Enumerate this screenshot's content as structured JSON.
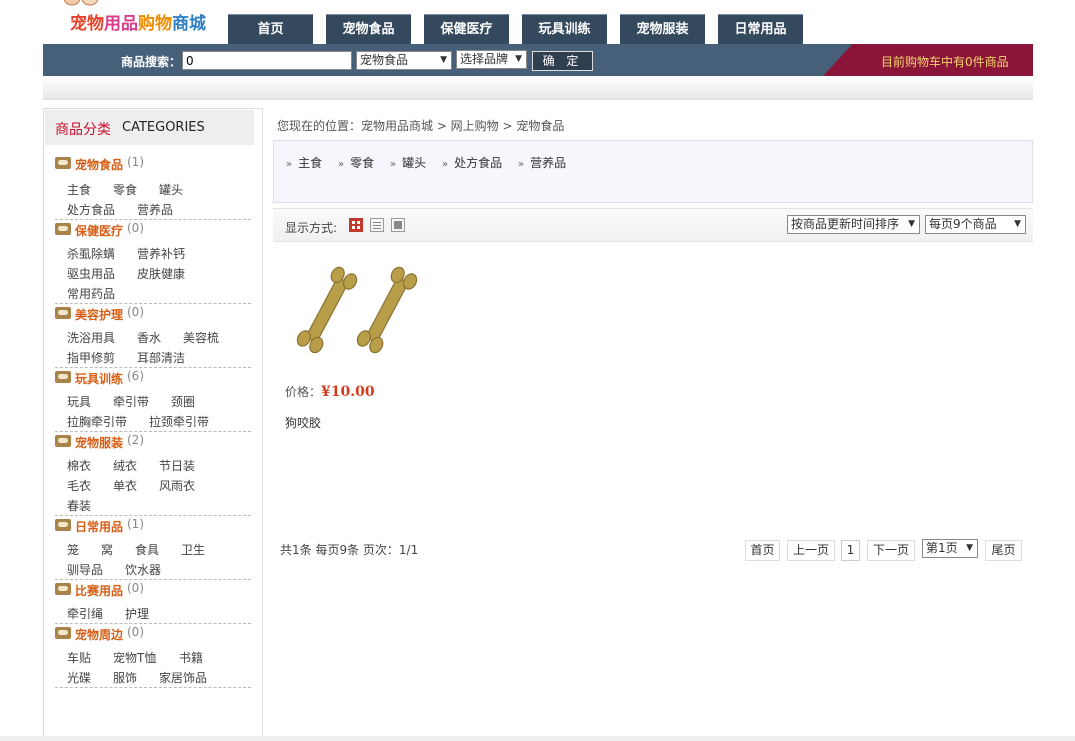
{
  "brand": {
    "name_chars": [
      "宠",
      "物",
      "用",
      "品",
      "购",
      "物",
      "商",
      "城"
    ],
    "colors": [
      "#e8432a",
      "#e8432a",
      "#d93c8a",
      "#d93c8a",
      "#f08c00",
      "#f08c00",
      "#2f7fc1",
      "#2f7fc1"
    ]
  },
  "nav": {
    "tabs": [
      "首页",
      "宠物食品",
      "保健医疗",
      "玩具训练",
      "宠物服装",
      "日常用品"
    ]
  },
  "search": {
    "label": "商品搜索：",
    "keyword": "0",
    "category_select": "宠物食品",
    "brand_select": "选择品牌",
    "submit": "确 定"
  },
  "cart": {
    "text": "目前购物车中有0件商品"
  },
  "sidebar": {
    "title_cn": "商品分类",
    "title_en": "CATEGORIES",
    "categories": [
      {
        "name": "宠物食品",
        "count": "(1)",
        "subs": [
          "主食",
          "零食",
          "罐头",
          "处方食品",
          "营养品"
        ]
      },
      {
        "name": "保健医疗",
        "count": "(0)",
        "subs": [
          "杀虱除螨",
          "营养补钙",
          "驱虫用品",
          "皮肤健康",
          "常用药品"
        ]
      },
      {
        "name": "美容护理",
        "count": "(0)",
        "subs": [
          "洗浴用具",
          "香水",
          "美容梳",
          "指甲修剪",
          "耳部清洁"
        ]
      },
      {
        "name": "玩具训练",
        "count": "(6)",
        "subs": [
          "玩具",
          "牵引带",
          "颈圈",
          "拉胸牵引带",
          "拉颈牵引带"
        ]
      },
      {
        "name": "宠物服装",
        "count": "(2)",
        "subs": [
          "棉衣",
          "绒衣",
          "节日装",
          "毛衣",
          "单衣",
          "风雨衣",
          "春装"
        ]
      },
      {
        "name": "日常用品",
        "count": "(1)",
        "subs": [
          "笼",
          "窝",
          "食具",
          "卫生",
          "驯导品",
          "饮水器"
        ]
      },
      {
        "name": "比赛用品",
        "count": "(0)",
        "subs": [
          "牵引绳",
          "护理"
        ]
      },
      {
        "name": "宠物周边",
        "count": "(0)",
        "subs": [
          "车贴",
          "宠物T恤",
          "书籍",
          "光碟",
          "服饰",
          "家居饰品"
        ]
      }
    ]
  },
  "breadcrumb": "您现在的位置：宠物用品商城 > 网上购物 > 宠物食品",
  "subcategories": [
    "主食",
    "零食",
    "罐头",
    "处方食品",
    "营养品"
  ],
  "toolbar": {
    "display_label": "显示方式:",
    "sort_select": "按商品更新时间排序",
    "per_page_select": "每页9个商品"
  },
  "product": {
    "price_label": "价格：",
    "price": "¥10.00",
    "name": "狗咬胶"
  },
  "pager": {
    "info": "共1条 每页9条 页次：1/1",
    "first": "首页",
    "prev": "上一页",
    "current": "1",
    "next": "下一页",
    "page_select": "第1页",
    "last": "尾页"
  }
}
